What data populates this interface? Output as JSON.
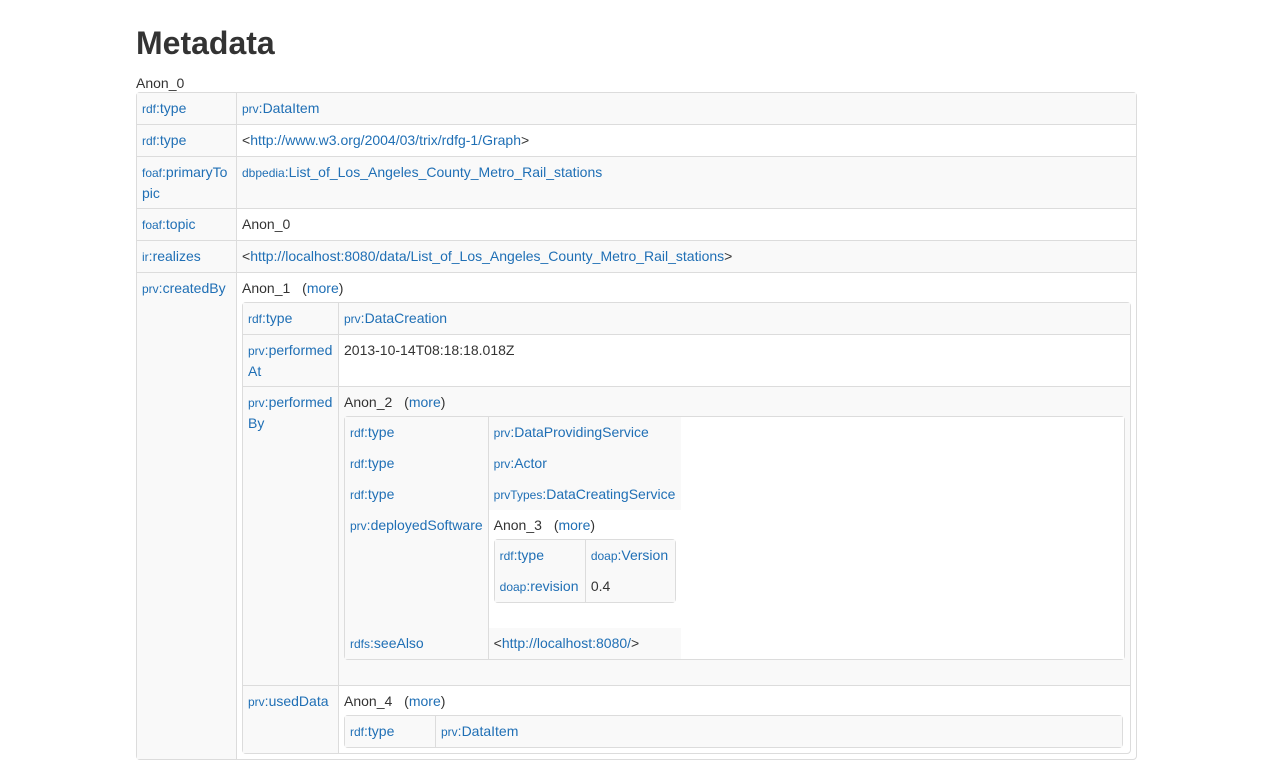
{
  "title": "Metadata",
  "subject": "Anon_0",
  "rows": {
    "r1": {
      "kp": "rdf",
      "kl": "type",
      "vp": "prv",
      "vl": "DataItem"
    },
    "r2": {
      "kp": "rdf",
      "kl": "type",
      "lt": "<",
      "url": "http://www.w3.org/2004/03/trix/rdfg-1/Graph",
      "gt": ">"
    },
    "r3": {
      "kp": "foaf",
      "kl": "primaryTopic",
      "vp": "dbpedia",
      "vl": "List_of_Los_Angeles_County_Metro_Rail_stations"
    },
    "r4": {
      "kp": "foaf",
      "kl": "topic",
      "v": "Anon_0"
    },
    "r5": {
      "kp": "ir",
      "kl": "realizes",
      "lt": "<",
      "url": "http://localhost:8080/data/List_of_Los_Angeles_County_Metro_Rail_stations",
      "gt": ">"
    },
    "r6": {
      "kp": "prv",
      "kl": "createdBy",
      "node": "Anon_1",
      "more_open": "(",
      "more": "more",
      "more_close": ")"
    }
  },
  "creation": {
    "r1": {
      "kp": "rdf",
      "kl": "type",
      "vp": "prv",
      "vl": "DataCreation"
    },
    "r2": {
      "kp": "prv",
      "kl": "performedAt",
      "v": "2013-10-14T08:18:18.018Z"
    },
    "r3": {
      "kp": "prv",
      "kl": "performedBy",
      "node": "Anon_2",
      "more": "more"
    },
    "r4": {
      "kp": "prv",
      "kl": "usedData",
      "node": "Anon_4",
      "more": "more"
    }
  },
  "service": {
    "r1": {
      "kp": "rdf",
      "kl": "type",
      "vp": "prv",
      "vl": "DataProvidingService"
    },
    "r2": {
      "kp": "rdf",
      "kl": "type",
      "vp": "prv",
      "vl": "Actor"
    },
    "r3": {
      "kp": "rdf",
      "kl": "type",
      "vp": "prvTypes",
      "vl": "DataCreatingService"
    },
    "r4": {
      "kp": "prv",
      "kl": "deployedSoftware",
      "node": "Anon_3",
      "more": "more"
    },
    "r5": {
      "kp": "rdfs",
      "kl": "seeAlso",
      "lt": "<",
      "url": "http://localhost:8080/",
      "gt": ">"
    }
  },
  "software": {
    "r1": {
      "kp": "rdf",
      "kl": "type",
      "vp": "doap",
      "vl": "Version"
    },
    "r2": {
      "kp": "doap",
      "kl": "revision",
      "v": "0.4"
    }
  },
  "useddata": {
    "r1": {
      "kp": "rdf",
      "kl": "type",
      "vp": "prv",
      "vl": "DataItem"
    }
  }
}
